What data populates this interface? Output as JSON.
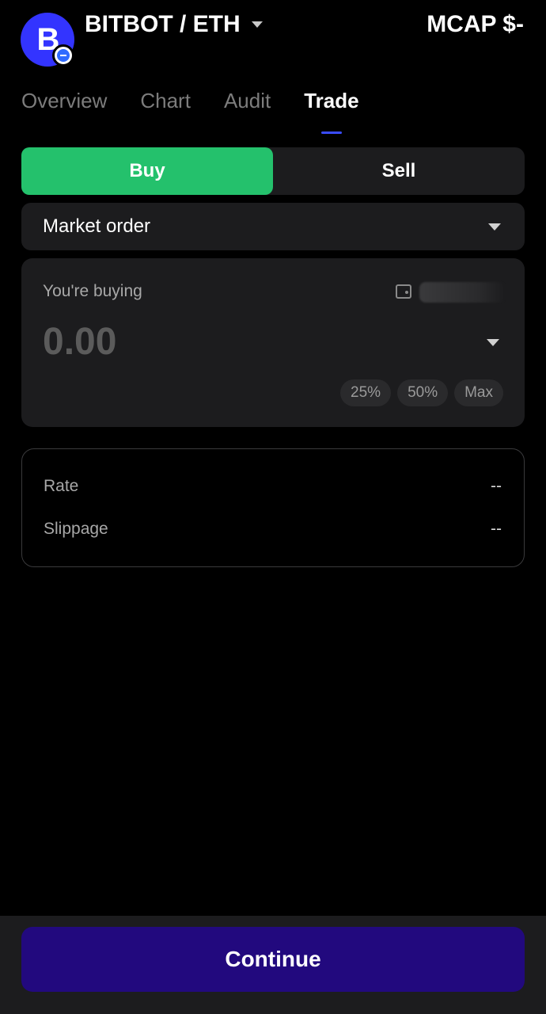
{
  "header": {
    "logo_letter": "B",
    "pair": "BITBOT / ETH",
    "mcap": "MCAP $-"
  },
  "tabs": [
    {
      "label": "Overview",
      "active": false
    },
    {
      "label": "Chart",
      "active": false
    },
    {
      "label": "Audit",
      "active": false
    },
    {
      "label": "Trade",
      "active": true
    }
  ],
  "trade": {
    "buy_label": "Buy",
    "sell_label": "Sell",
    "order_type": "Market order",
    "amount_label": "You're buying",
    "amount_placeholder": "0.00",
    "percent_options": [
      "25%",
      "50%",
      "Max"
    ]
  },
  "info": {
    "rate_label": "Rate",
    "rate_value": "--",
    "slippage_label": "Slippage",
    "slippage_value": "--"
  },
  "footer": {
    "continue_label": "Continue"
  },
  "colors": {
    "buy_green": "#24c16c",
    "accent_blue": "#3334ff",
    "continue_purple": "#22097e"
  },
  "icons": [
    "chevron-down-icon",
    "wallet-icon",
    "chain-badge-icon"
  ]
}
